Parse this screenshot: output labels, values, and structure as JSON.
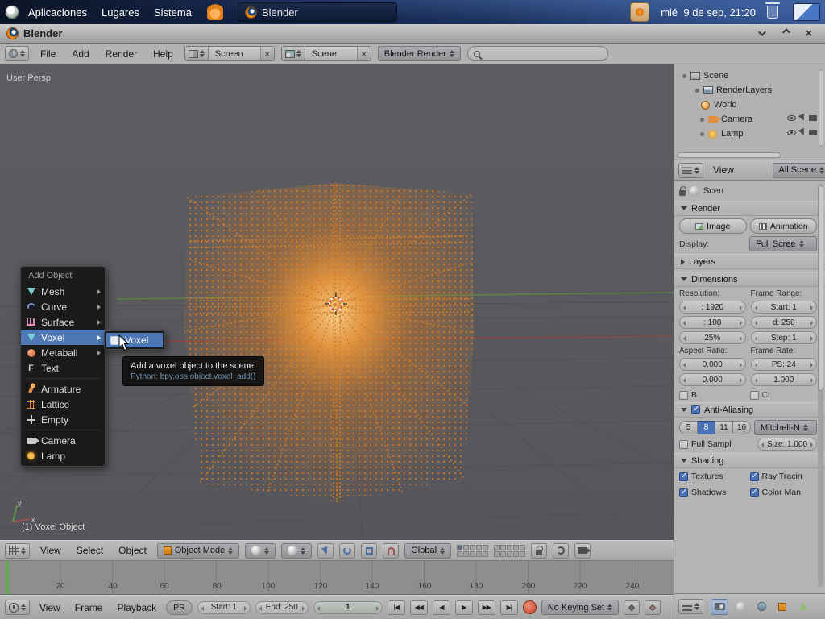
{
  "desktop_panel": {
    "menus": [
      {
        "label": "Aplicaciones"
      },
      {
        "label": "Lugares"
      },
      {
        "label": "Sistema"
      }
    ],
    "window_button": {
      "label": "Blender"
    },
    "clock": "mié  9 de sep, 21:20"
  },
  "window": {
    "title": "Blender"
  },
  "info_header": {
    "menus": [
      {
        "label": "File"
      },
      {
        "label": "Add"
      },
      {
        "label": "Render"
      },
      {
        "label": "Help"
      }
    ],
    "screen_selector": "Screen",
    "scene_selector": "Scene",
    "engine_selector": "Blender Render",
    "search_placeholder": ""
  },
  "viewport": {
    "view_label": "User Persp",
    "object_label": "(1) Voxel Object",
    "axis_x": "x",
    "axis_y": "y"
  },
  "add_menu": {
    "title": "Add Object",
    "items": [
      {
        "label": "Mesh",
        "icon": "mesh-icon",
        "submenu": true
      },
      {
        "label": "Curve",
        "icon": "curve-icon",
        "submenu": true
      },
      {
        "label": "Surface",
        "icon": "surface-icon",
        "submenu": true
      },
      {
        "label": "Voxel",
        "icon": "voxel-icon",
        "submenu": true,
        "highlighted": true
      },
      {
        "label": "Metaball",
        "icon": "metaball-icon",
        "submenu": true
      },
      {
        "label": "Text",
        "icon": "text-icon"
      },
      {
        "label": "Armature",
        "icon": "armature-icon"
      },
      {
        "label": "Lattice",
        "icon": "lattice-icon"
      },
      {
        "label": "Empty",
        "icon": "empty-icon"
      },
      {
        "label": "Camera",
        "icon": "camera-icon"
      },
      {
        "label": "Lamp",
        "icon": "lamp-icon"
      }
    ],
    "submenu_item": "Voxel",
    "tooltip_line1": "Add a voxel object to the scene.",
    "tooltip_line2": "Python: bpy.ops.object.voxel_add()"
  },
  "outliner": {
    "items": [
      {
        "label": "Scene"
      },
      {
        "label": "RenderLayers"
      },
      {
        "label": "World"
      },
      {
        "label": "Camera"
      },
      {
        "label": "Lamp"
      }
    ],
    "header": {
      "view_menu": "View",
      "display_mode": "All Scene"
    }
  },
  "properties": {
    "breadcrumb": "Scen",
    "render": {
      "title": "Render",
      "image_button": "Image",
      "animation_button": "Animation",
      "display_label": "Display:",
      "display_value": "Full Scree"
    },
    "layers": {
      "title": "Layers"
    },
    "dimensions": {
      "title": "Dimensions",
      "resolution_label": "Resolution:",
      "frame_range_label": "Frame Range:",
      "res_x": ": 1920",
      "res_y": ": 108",
      "res_pct": "25%",
      "frame_start": "Start: 1",
      "frame_end": "d: 250",
      "frame_step": "Step: 1",
      "aspect_label": "Aspect Ratio:",
      "frame_rate_label": "Frame Rate:",
      "aspect_x": "0.000",
      "aspect_y": "0.000",
      "fps": "PS: 24",
      "fps_base": "1.000",
      "border_label": "B",
      "crop_label": "Cr"
    },
    "antialiasing": {
      "title": "Anti-Aliasing",
      "samples": [
        "5",
        "8",
        "11",
        "16"
      ],
      "active_sample": "8",
      "filter_value": "Mitchell-N",
      "full_sample_label": "Full Sampl",
      "size_value": "Size: 1.000"
    },
    "shading": {
      "title": "Shading",
      "options": [
        {
          "label": "Textures",
          "checked": true
        },
        {
          "label": "Ray Tracin",
          "checked": true
        },
        {
          "label": "Shadows",
          "checked": true
        },
        {
          "label": "Color Man",
          "checked": true
        }
      ]
    }
  },
  "view3d_header": {
    "menus": [
      {
        "label": "View"
      },
      {
        "label": "Select"
      },
      {
        "label": "Object"
      }
    ],
    "mode_selector": "Object Mode",
    "orientation_selector": "Global"
  },
  "timeline": {
    "ruler_ticks": [
      "20",
      "40",
      "60",
      "80",
      "100",
      "120",
      "140",
      "160",
      "180",
      "200",
      "220",
      "240"
    ],
    "menus": [
      {
        "label": "View"
      },
      {
        "label": "Frame"
      },
      {
        "label": "Playback"
      }
    ],
    "preview_button": "PR",
    "start_field": "Start: 1",
    "end_field": "End: 250",
    "current_frame": "1",
    "playback_buttons": [
      {
        "name": "jump-to-start",
        "glyph": "|◀"
      },
      {
        "name": "prev-keyframe",
        "glyph": "◀◀"
      },
      {
        "name": "play-reverse",
        "glyph": "◀"
      },
      {
        "name": "play",
        "glyph": "▶"
      },
      {
        "name": "next-keyframe",
        "glyph": "▶▶"
      },
      {
        "name": "jump-to-end",
        "glyph": "▶|"
      }
    ],
    "keying_set_selector": "No Keying Set"
  }
}
